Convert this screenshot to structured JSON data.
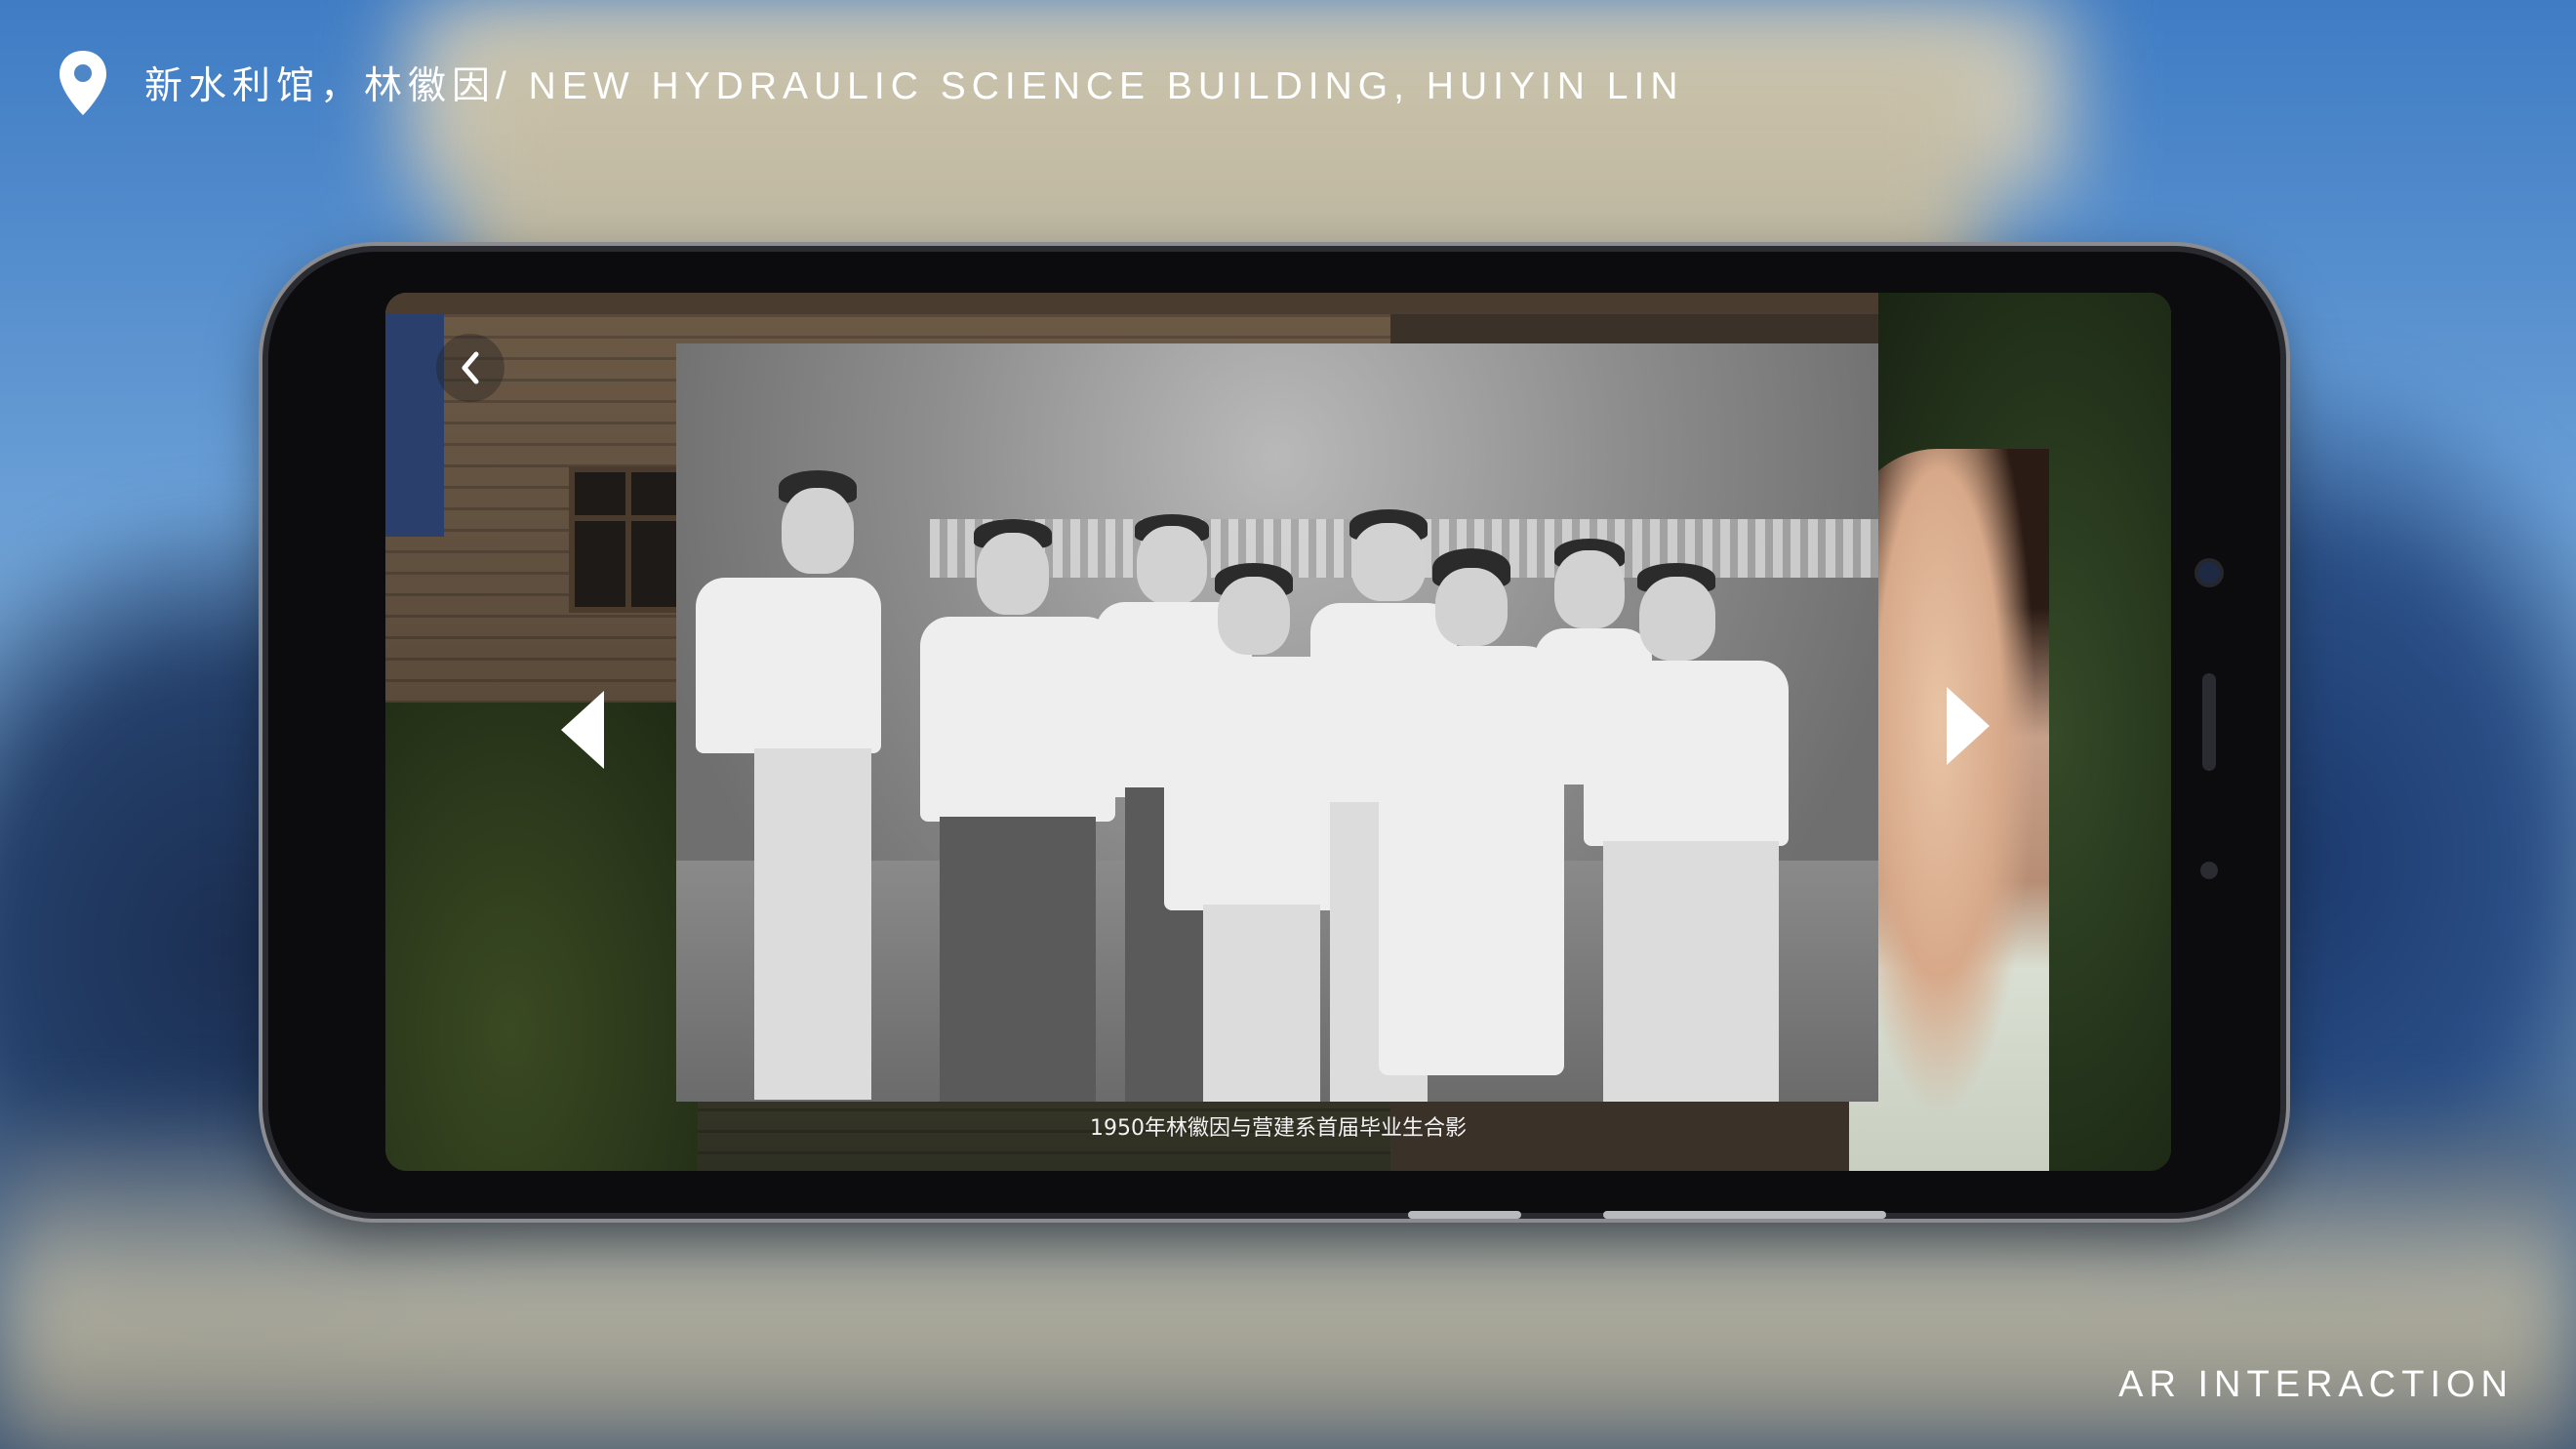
{
  "header": {
    "location_icon": "map-pin-icon",
    "title": "新水利馆，林徽因/ NEW HYDRAULIC SCIENCE BUILDING, HUIYIN LIN"
  },
  "footer": {
    "label": "AR INTERACTION"
  },
  "phone": {
    "back_icon": "chevron-left-icon",
    "prev_icon": "triangle-left-icon",
    "next_icon": "triangle-right-icon",
    "photo_caption": "1950年林徽因与营建系首届毕业生合影"
  },
  "colors": {
    "text": "#ffffff",
    "phone_body": "#0c0c0e",
    "sky": "#4a7bb8"
  }
}
